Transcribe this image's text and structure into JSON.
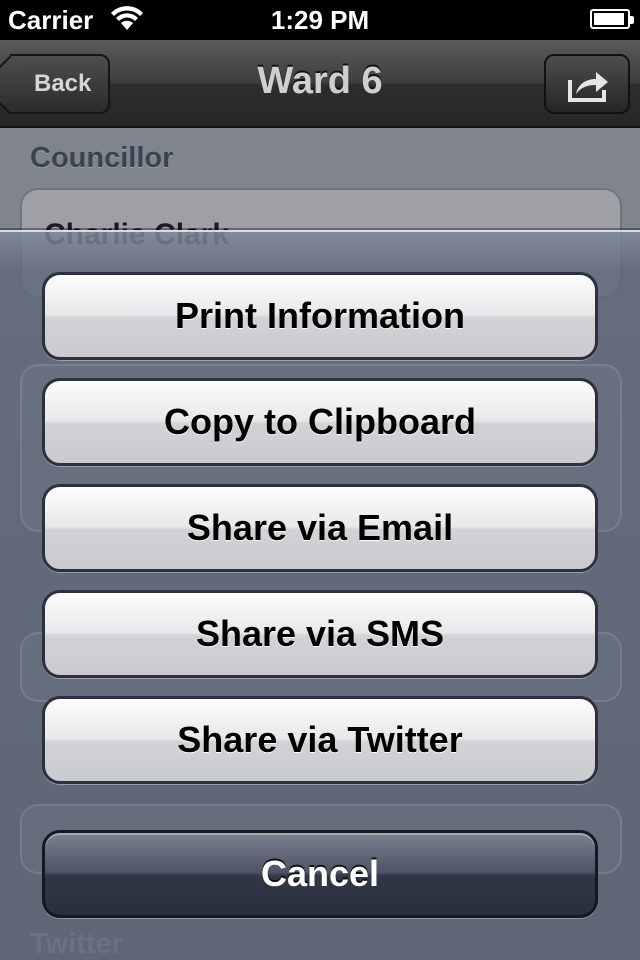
{
  "status_bar": {
    "carrier": "Carrier",
    "time": "1:29 PM"
  },
  "nav": {
    "title": "Ward 6",
    "back_label": "Back",
    "share_icon": "share-arrow-icon"
  },
  "content": {
    "councillor_label": "Councillor",
    "councillor_value": "Charlie Clark",
    "hidden_section_label": "Twitter"
  },
  "action_sheet": {
    "buttons": [
      "Print Information",
      "Copy to Clipboard",
      "Share via Email",
      "Share via SMS",
      "Share via Twitter"
    ],
    "cancel_label": "Cancel"
  },
  "colors": {
    "nav_bar": "#333333",
    "sheet_background": "#5a6274",
    "cancel_button": "#343a4a"
  }
}
